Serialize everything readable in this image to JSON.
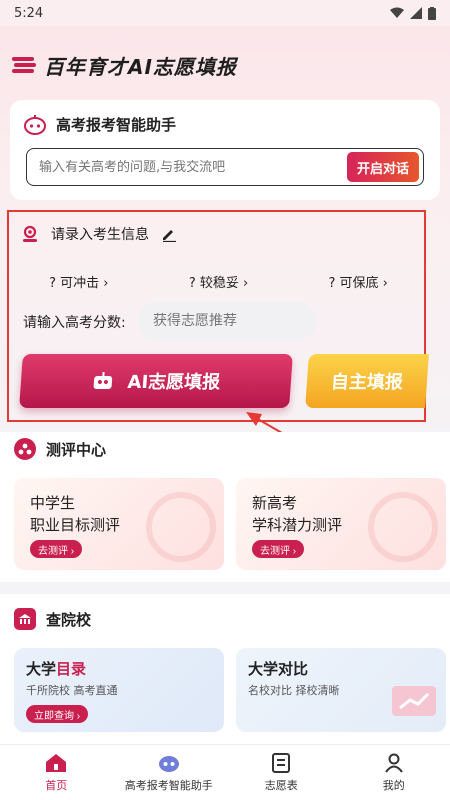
{
  "status": {
    "time": "5:24"
  },
  "app": {
    "title": "百年育才AI志愿填报"
  },
  "assistant": {
    "title": "高考报考智能助手",
    "placeholder": "输入有关高考的问题,与我交流吧",
    "button": "开启对话"
  },
  "info": {
    "title": "请录入考生信息",
    "options": [
      "? 可冲击 ›",
      "? 较稳妥 ›",
      "? 可保底 ›"
    ],
    "score_label": "请输入高考分数:",
    "score_placeholder": "获得志愿推荐",
    "ai_button": "AI志愿填报",
    "self_button": "自主填报"
  },
  "eval": {
    "title": "测评中心",
    "cards": [
      {
        "line1": "中学生",
        "line2": "职业目标测评",
        "action": "去测评 ›"
      },
      {
        "line1": "新高考",
        "line2": "学科潜力测评",
        "action": "去测评 ›"
      }
    ]
  },
  "schools": {
    "title": "查院校",
    "cards": [
      {
        "title_a": "大学",
        "title_b": "目录",
        "subtitle": "千所院校 高考直通",
        "action": "立即查询 ›"
      },
      {
        "title": "大学对比",
        "subtitle": "名校对比 择校清晰"
      }
    ]
  },
  "tabs": [
    "首页",
    "高考报考智能助手",
    "志愿表",
    "我的"
  ],
  "colors": {
    "brand": "#c9204f",
    "accent_orange": "#f4a522",
    "annotation": "#e53935"
  }
}
